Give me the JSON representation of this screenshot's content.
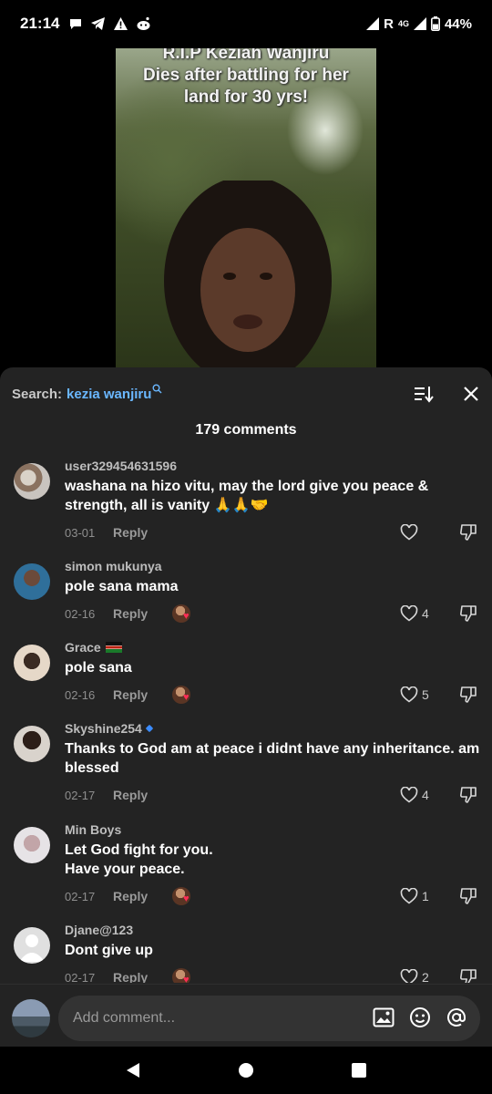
{
  "status_bar": {
    "time": "21:14",
    "network_label": "R",
    "network_type": "4G",
    "battery": "44%",
    "left_icons": [
      "chat-bubble-icon",
      "telegram-icon",
      "warning-icon",
      "reddit-icon"
    ]
  },
  "video": {
    "caption_line1": "R.I.P Keziah Wanjiru",
    "caption_line2": "Dies after battling for her",
    "caption_line3": "land for 30 yrs!"
  },
  "header": {
    "search_label": "Search:",
    "search_term": "kezia wanjiru"
  },
  "comments_count": "179 comments",
  "comments": [
    {
      "username": "user329454631596",
      "text": "washana na hizo vitu, may the lord give you peace & strength, all is vanity 🙏🙏🤝",
      "date": "03-01",
      "reply": "Reply",
      "likes": "",
      "creator_liked": false
    },
    {
      "username": "simon mukunya",
      "text": "pole sana mama",
      "date": "02-16",
      "reply": "Reply",
      "likes": "4",
      "creator_liked": true
    },
    {
      "username": "Grace",
      "text": "pole sana",
      "date": "02-16",
      "reply": "Reply",
      "likes": "5",
      "creator_liked": true
    },
    {
      "username": "Skyshine254",
      "text": "Thanks to God am at peace i didnt have any inheritance. am blessed",
      "date": "02-17",
      "reply": "Reply",
      "likes": "4",
      "creator_liked": false
    },
    {
      "username": "Min Boys",
      "text": "Let God fight for you.\nHave your peace.",
      "date": "02-17",
      "reply": "Reply",
      "likes": "1",
      "creator_liked": true
    },
    {
      "username": "Djane@123",
      "text": "Dont give up",
      "date": "02-17",
      "reply": "Reply",
      "likes": "2",
      "creator_liked": true
    }
  ],
  "input": {
    "placeholder": "Add comment..."
  },
  "colors": {
    "sheet_bg": "#232323",
    "accent_blue": "#6ab7ff",
    "heart_red": "#ff2d55"
  }
}
